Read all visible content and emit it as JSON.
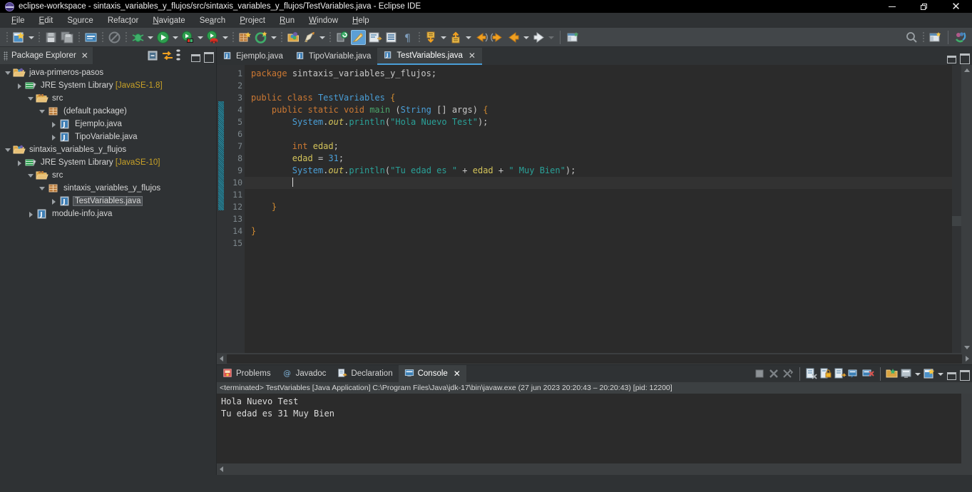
{
  "window": {
    "title": "eclipse-workspace - sintaxis_variables_y_flujos/src/sintaxis_variables_y_flujos/TestVariables.java - Eclipse IDE",
    "logo_icon": "eclipse-logo-icon",
    "minimize_label": "Minimize",
    "maximize_label": "Restore",
    "close_label": "Close"
  },
  "menubar": {
    "items": [
      {
        "label": "File",
        "mnemonic": "F"
      },
      {
        "label": "Edit",
        "mnemonic": "E"
      },
      {
        "label": "Source",
        "mnemonic": "S"
      },
      {
        "label": "Refactor",
        "mnemonic": "t"
      },
      {
        "label": "Navigate",
        "mnemonic": "N"
      },
      {
        "label": "Search",
        "mnemonic": "a"
      },
      {
        "label": "Project",
        "mnemonic": "P"
      },
      {
        "label": "Run",
        "mnemonic": "R"
      },
      {
        "label": "Window",
        "mnemonic": "W"
      },
      {
        "label": "Help",
        "mnemonic": "H"
      }
    ]
  },
  "toolbar": {
    "items": [
      {
        "name": "new-wizard-icon",
        "tooltip": "New"
      },
      {
        "name": "save-icon",
        "tooltip": "Save"
      },
      {
        "name": "save-all-icon",
        "tooltip": "Save All"
      },
      {
        "name": "print-icon",
        "tooltip": "Print"
      },
      {
        "name": "no-entry-icon",
        "tooltip": "Skip All Breakpoints"
      },
      {
        "name": "debug-icon",
        "tooltip": "Debug"
      },
      {
        "name": "run-icon",
        "tooltip": "Run"
      },
      {
        "name": "run-external-tools-icon",
        "tooltip": "External Tools"
      },
      {
        "name": "run-coverage-icon",
        "tooltip": "Coverage"
      },
      {
        "name": "new-java-package-icon",
        "tooltip": "New Java Package"
      },
      {
        "name": "new-java-class-icon",
        "tooltip": "New Java Class"
      },
      {
        "name": "open-type-icon",
        "tooltip": "Open Type"
      },
      {
        "name": "search-icon",
        "tooltip": "Search"
      },
      {
        "name": "toggle-mark-occurrences-icon",
        "tooltip": "Toggle Mark Occurrences"
      },
      {
        "name": "new-java-project-icon",
        "tooltip": "New Java Project"
      },
      {
        "name": "link-with-editor-icon",
        "tooltip": "Link"
      },
      {
        "name": "show-whitespace-icon",
        "tooltip": "Show Whitespace Characters"
      },
      {
        "name": "pilcrow-icon",
        "tooltip": "Show Print Margin"
      },
      {
        "name": "next-annotation-icon",
        "tooltip": "Next Annotation"
      },
      {
        "name": "previous-annotation-icon",
        "tooltip": "Previous Annotation"
      },
      {
        "name": "back-history-icon",
        "tooltip": "Back"
      },
      {
        "name": "forward-history-icon",
        "tooltip": "Forward"
      },
      {
        "name": "last-edit-location-icon",
        "tooltip": "Last Edit Location"
      },
      {
        "name": "open-perspective-icon",
        "tooltip": "Open Perspective"
      }
    ],
    "right_items": [
      {
        "name": "quick-access-search-icon",
        "tooltip": "Quick Access"
      },
      {
        "name": "overflow-dots-icon",
        "tooltip": "More"
      },
      {
        "name": "open-perspective-icon",
        "tooltip": "Open Perspective"
      },
      {
        "name": "java-perspective-icon",
        "tooltip": "Java"
      }
    ]
  },
  "explorer": {
    "tab_label": "Package Explorer",
    "tab_icon": "package-explorer-icon",
    "close_icon": "close-icon",
    "view_buttons": [
      {
        "name": "collapse-all-icon",
        "label": "Collapse All"
      },
      {
        "name": "link-with-editor-icon",
        "label": "Link with Editor"
      },
      {
        "name": "view-menu-icon",
        "label": "View Menu"
      },
      {
        "name": "minimize-view-icon",
        "label": "Minimize"
      },
      {
        "name": "maximize-view-icon",
        "label": "Maximize"
      }
    ],
    "tree": [
      {
        "label": "java-primeros-pasos",
        "icon": "java-project-icon",
        "indent": 0,
        "state": "open",
        "selected": false
      },
      {
        "label": "JRE System Library [JavaSE-1.8]",
        "icon": "jre-library-icon",
        "indent": 1,
        "state": "closed",
        "selected": false,
        "suffix": "[JavaSE-1.8]",
        "base": "JRE System Library "
      },
      {
        "label": "src",
        "icon": "source-folder-icon",
        "indent": 1,
        "state": "open",
        "selected": false
      },
      {
        "label": "(default package)",
        "icon": "package-icon",
        "indent": 2,
        "state": "open",
        "selected": false
      },
      {
        "label": "Ejemplo.java",
        "icon": "java-file-icon",
        "indent": 3,
        "state": "closed",
        "selected": false
      },
      {
        "label": "TipoVariable.java",
        "icon": "java-file-icon",
        "indent": 3,
        "state": "closed",
        "selected": false
      },
      {
        "label": "sintaxis_variables_y_flujos",
        "icon": "java-project-icon",
        "indent": 0,
        "state": "open",
        "selected": false
      },
      {
        "label": "JRE System Library [JavaSE-10]",
        "icon": "jre-library-icon",
        "indent": 1,
        "state": "closed",
        "selected": false,
        "suffix": "[JavaSE-10]",
        "base": "JRE System Library "
      },
      {
        "label": "src",
        "icon": "source-folder-icon",
        "indent": 1,
        "state": "open",
        "selected": false
      },
      {
        "label": "sintaxis_variables_y_flujos",
        "icon": "package-icon",
        "indent": 2,
        "state": "open",
        "selected": false
      },
      {
        "label": "TestVariables.java",
        "icon": "java-file-icon",
        "indent": 3,
        "state": "closed",
        "selected": true
      },
      {
        "label": "module-info.java",
        "icon": "java-file-icon",
        "indent": 2,
        "state": "closed",
        "selected": false
      }
    ]
  },
  "editor": {
    "tabs": [
      {
        "label": "Ejemplo.java",
        "icon": "java-file-icon",
        "active": false
      },
      {
        "label": "TipoVariable.java",
        "icon": "java-file-icon",
        "active": false
      },
      {
        "label": "TestVariables.java",
        "icon": "java-file-icon",
        "active": true,
        "close_icon": "close-icon"
      }
    ],
    "view_buttons": [
      {
        "name": "minimize-editor-icon",
        "label": "Minimize"
      },
      {
        "name": "maximize-editor-icon",
        "label": "Maximize"
      }
    ],
    "line_numbers": [
      "1",
      "2",
      "3",
      "4",
      "5",
      "6",
      "7",
      "8",
      "9",
      "10",
      "11",
      "12",
      "13",
      "14",
      "15"
    ],
    "breakpoint_line": 4,
    "current_line": 10,
    "lines": [
      {
        "n": 1,
        "text": "package sintaxis_variables_y_flujos;"
      },
      {
        "n": 2,
        "text": ""
      },
      {
        "n": 3,
        "text": "public class TestVariables {"
      },
      {
        "n": 4,
        "text": "    public static void main (String [] args) {"
      },
      {
        "n": 5,
        "text": "        System.out.println(\"Hola Nuevo Test\");"
      },
      {
        "n": 6,
        "text": ""
      },
      {
        "n": 7,
        "text": "        int edad;"
      },
      {
        "n": 8,
        "text": "        edad = 31;"
      },
      {
        "n": 9,
        "text": "        System.out.println(\"Tu edad es \" + edad + \" Muy Bien\");"
      },
      {
        "n": 10,
        "text": "        "
      },
      {
        "n": 11,
        "text": ""
      },
      {
        "n": 12,
        "text": "    }"
      },
      {
        "n": 13,
        "text": ""
      },
      {
        "n": 14,
        "text": "}"
      },
      {
        "n": 15,
        "text": ""
      }
    ]
  },
  "console": {
    "tabs": [
      {
        "label": "Problems",
        "icon": "problems-icon",
        "active": false
      },
      {
        "label": "Javadoc",
        "icon": "javadoc-icon",
        "active": false
      },
      {
        "label": "Declaration",
        "icon": "declaration-icon",
        "active": false
      },
      {
        "label": "Console",
        "icon": "console-icon",
        "active": true,
        "close_icon": "close-icon"
      }
    ],
    "toolbar": [
      {
        "name": "terminate-icon",
        "label": "Terminate"
      },
      {
        "name": "remove-launch-icon",
        "label": "Remove Launch"
      },
      {
        "name": "remove-all-terminated-icon",
        "label": "Remove All Terminated Launches"
      },
      {
        "name": "clear-console-icon",
        "label": "Clear Console"
      },
      {
        "name": "scroll-lock-icon",
        "label": "Scroll Lock"
      },
      {
        "name": "word-wrap-icon",
        "label": "Word Wrap"
      },
      {
        "name": "show-console-on-output-icon",
        "label": "Show Console When Output Changes"
      },
      {
        "name": "show-console-on-error-icon",
        "label": "Show Console When Error Changes"
      },
      {
        "name": "pin-console-icon",
        "label": "Pin Console"
      },
      {
        "name": "display-selected-console-icon",
        "label": "Display Selected Console"
      },
      {
        "name": "open-console-icon",
        "label": "Open Console"
      },
      {
        "name": "minimize-console-icon",
        "label": "Minimize"
      },
      {
        "name": "maximize-console-icon",
        "label": "Maximize"
      }
    ],
    "status_line": "<terminated> TestVariables [Java Application] C:\\Program Files\\Java\\jdk-17\\bin\\javaw.exe (27 jun 2023 20:20:43 – 20:20:43) [pid: 12200]",
    "output": [
      "Hola Nuevo Test",
      "Tu edad es 31 Muy Bien"
    ]
  },
  "colors": {
    "window_bg": "#2f3234",
    "toolbar_bg": "#424649",
    "editor_bg": "#2b2b2b",
    "gutter_bg": "#313335",
    "tab_active_bg": "#3c4042",
    "tab_accent": "#4a9fd8",
    "keyword": "#cc7832",
    "type": "#4a9fd8",
    "string": "#2aa198",
    "variable": "#d4c45a",
    "number": "#4a9fd8",
    "method": "#4aa36a",
    "text": "#d0d0d0",
    "change_bar": "#2c8a9e"
  }
}
